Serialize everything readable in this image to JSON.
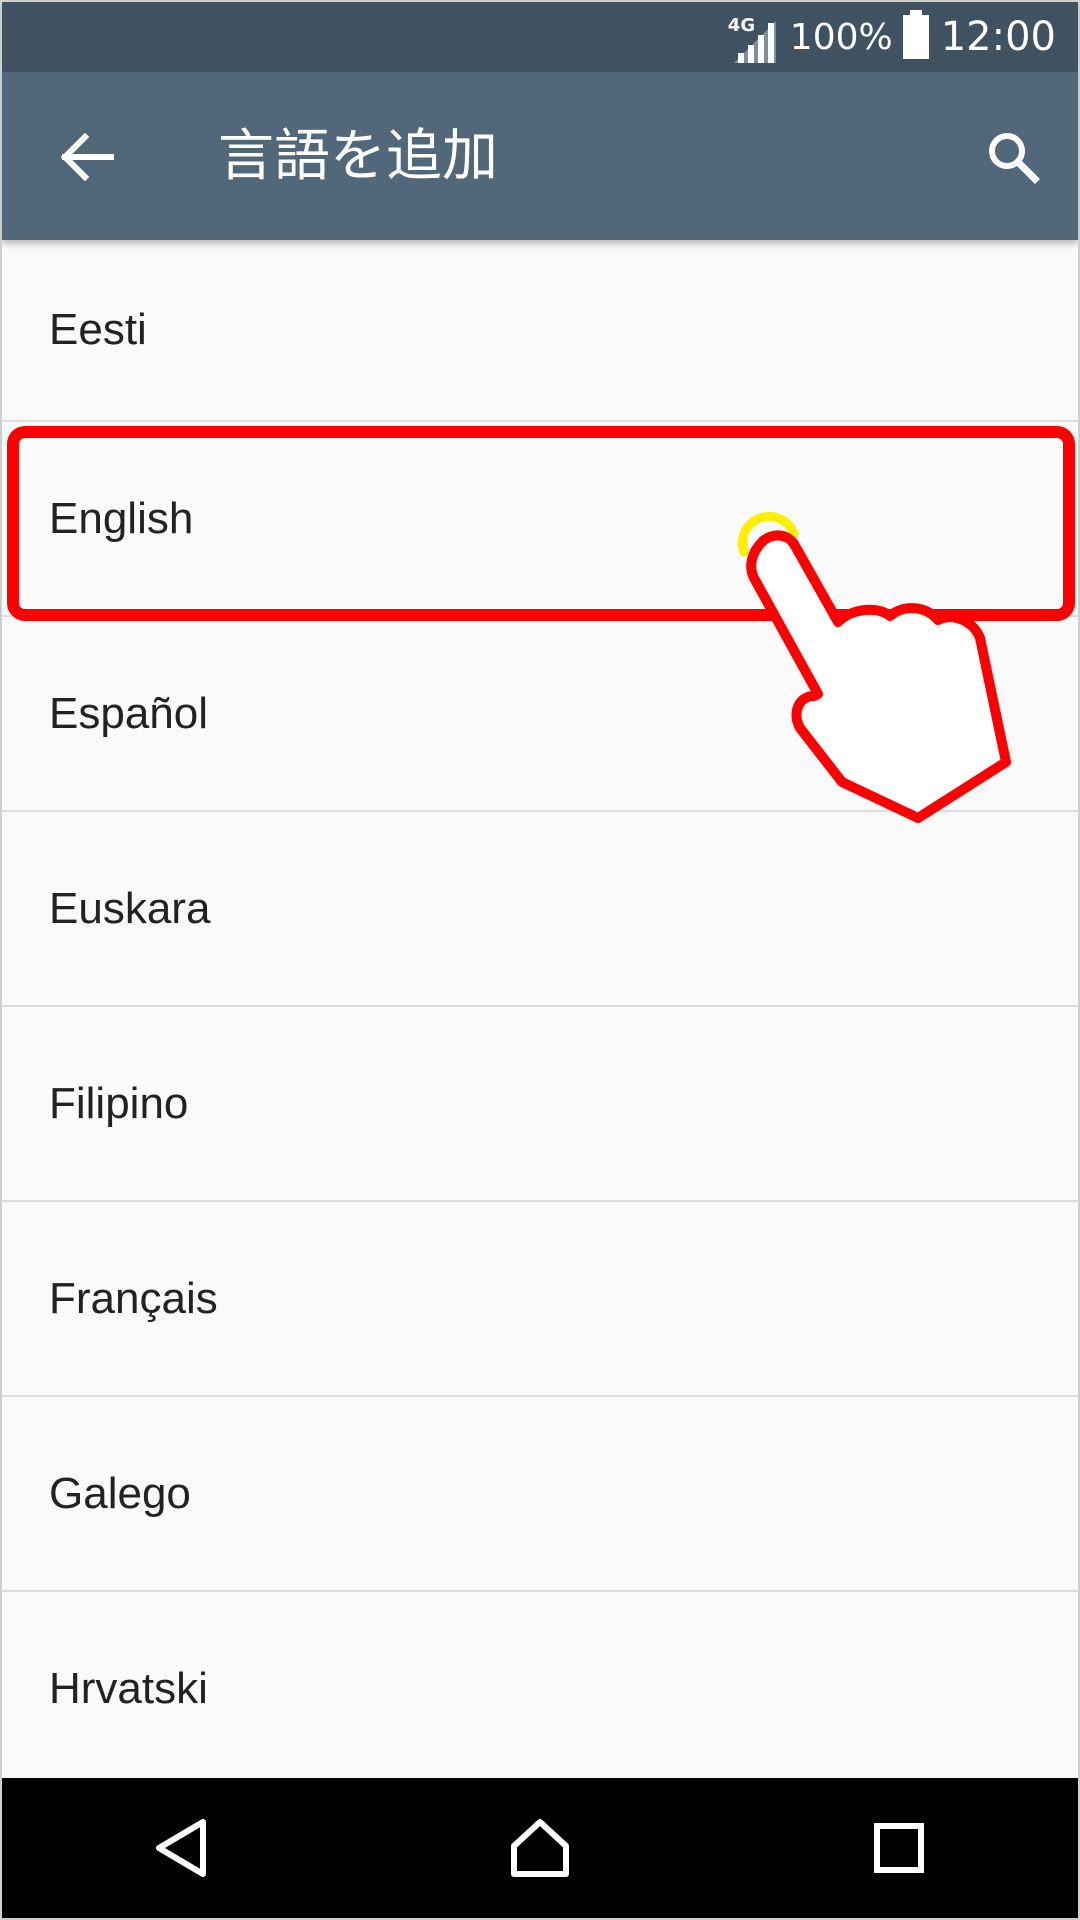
{
  "status_bar": {
    "network": "4G",
    "battery_percent": "100%",
    "time": "12:00"
  },
  "app_bar": {
    "title": "言語を追加",
    "back_icon": "arrow-back-icon",
    "search_icon": "search-icon"
  },
  "languages": [
    {
      "label": "Eesti"
    },
    {
      "label": "English"
    },
    {
      "label": "Español"
    },
    {
      "label": "Euskara"
    },
    {
      "label": "Filipino"
    },
    {
      "label": "Français"
    },
    {
      "label": "Galego"
    },
    {
      "label": "Hrvatski"
    }
  ],
  "annotation": {
    "highlighted_item": "English",
    "highlight_color": "#ff0000",
    "pointer_icon": "hand-pointer-icon"
  },
  "nav_bar": {
    "back_icon": "nav-back-icon",
    "home_icon": "nav-home-icon",
    "recents_icon": "nav-recents-icon"
  },
  "colors": {
    "status_bar": "#3f5261",
    "app_bar": "#51677a",
    "background": "#fafafa"
  }
}
